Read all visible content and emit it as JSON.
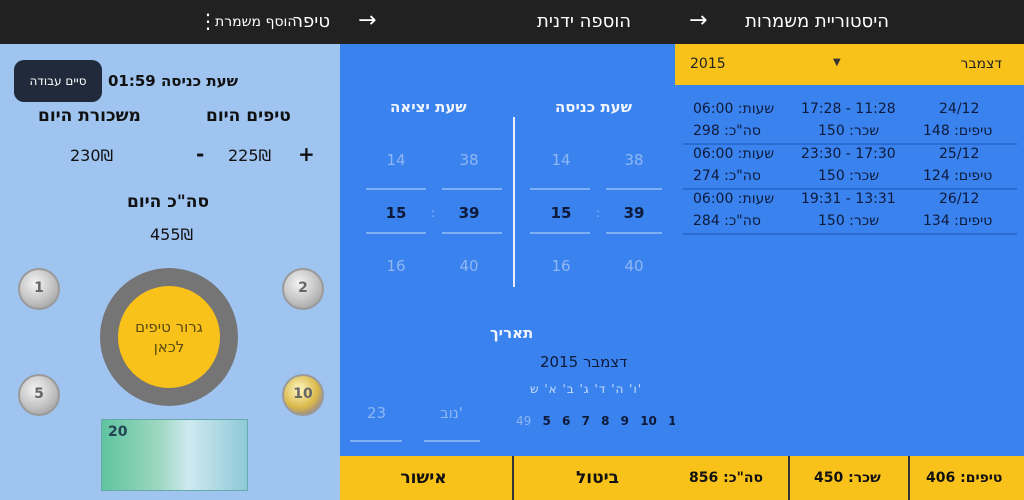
{
  "panel1": {
    "title": "טיפר",
    "add_shift": "הוסף משמרת",
    "menu_icon": "more-vert-icon",
    "end_work_button": "סיים עבודה",
    "entry_label": "שעת כניסה 01:59",
    "tips_today_label": "טיפים היום",
    "salary_today_label": "משכורת היום",
    "tips_today_value": "225₪",
    "salary_today_value": "230₪",
    "plus": "+",
    "minus": "-",
    "total_today_label": "סה\"כ היום",
    "total_today_value": "455₪",
    "drag_tips_label": "גרור טיפים לכאן",
    "coin_1": "1",
    "coin_2": "2",
    "coin_5": "5",
    "coin_10": "10",
    "banknote": "20"
  },
  "panel2": {
    "title": "הוספה ידנית",
    "back_icon": "arrow-back-icon",
    "entry_time_label": "שעת כניסה",
    "exit_time_label": "שעת יציאה",
    "entry_minutes": [
      "38",
      "39",
      "40"
    ],
    "entry_hours": [
      "14",
      "15",
      "16"
    ],
    "exit_minutes": [
      "38",
      "39",
      "40"
    ],
    "exit_hours": [
      "14",
      "15",
      "16"
    ],
    "colon": ":",
    "date_label": "תאריך",
    "calendar_month": "דצמבר 2015",
    "calendar_weekdays": "ו' ה' ד' ג' ב' א' ש'",
    "calendar_days": [
      "11",
      "10",
      "9",
      "8",
      "7",
      "6",
      "5"
    ],
    "calendar_prev_day": "49",
    "mini_month": "נוב'",
    "mini_day": "23",
    "confirm_button": "אישור",
    "cancel_button": "ביטול"
  },
  "panel3": {
    "title": "היסטוריית משמרות",
    "back_icon": "arrow-back-icon",
    "month_filter": "דצמבר",
    "year_filter": "2015",
    "caret_icon": "dropdown-caret-icon",
    "shifts": [
      {
        "date": "24/12",
        "range": "17:28 - 11:28",
        "hours": "שעות: 06:00",
        "tips": "טיפים: 148",
        "salary": "שכר: 150",
        "total": "סה\"כ: 298"
      },
      {
        "date": "25/12",
        "range": "23:30 - 17:30",
        "hours": "שעות: 06:00",
        "tips": "טיפים: 124",
        "salary": "שכר: 150",
        "total": "סה\"כ: 274"
      },
      {
        "date": "26/12",
        "range": "19:31 - 13:31",
        "hours": "שעות: 06:00",
        "tips": "טיפים: 134",
        "salary": "שכר: 150",
        "total": "סה\"כ: 284"
      }
    ],
    "summary_tips": "טיפים: 406",
    "summary_salary": "שכר: 450",
    "summary_total": "סה\"כ: 856"
  }
}
